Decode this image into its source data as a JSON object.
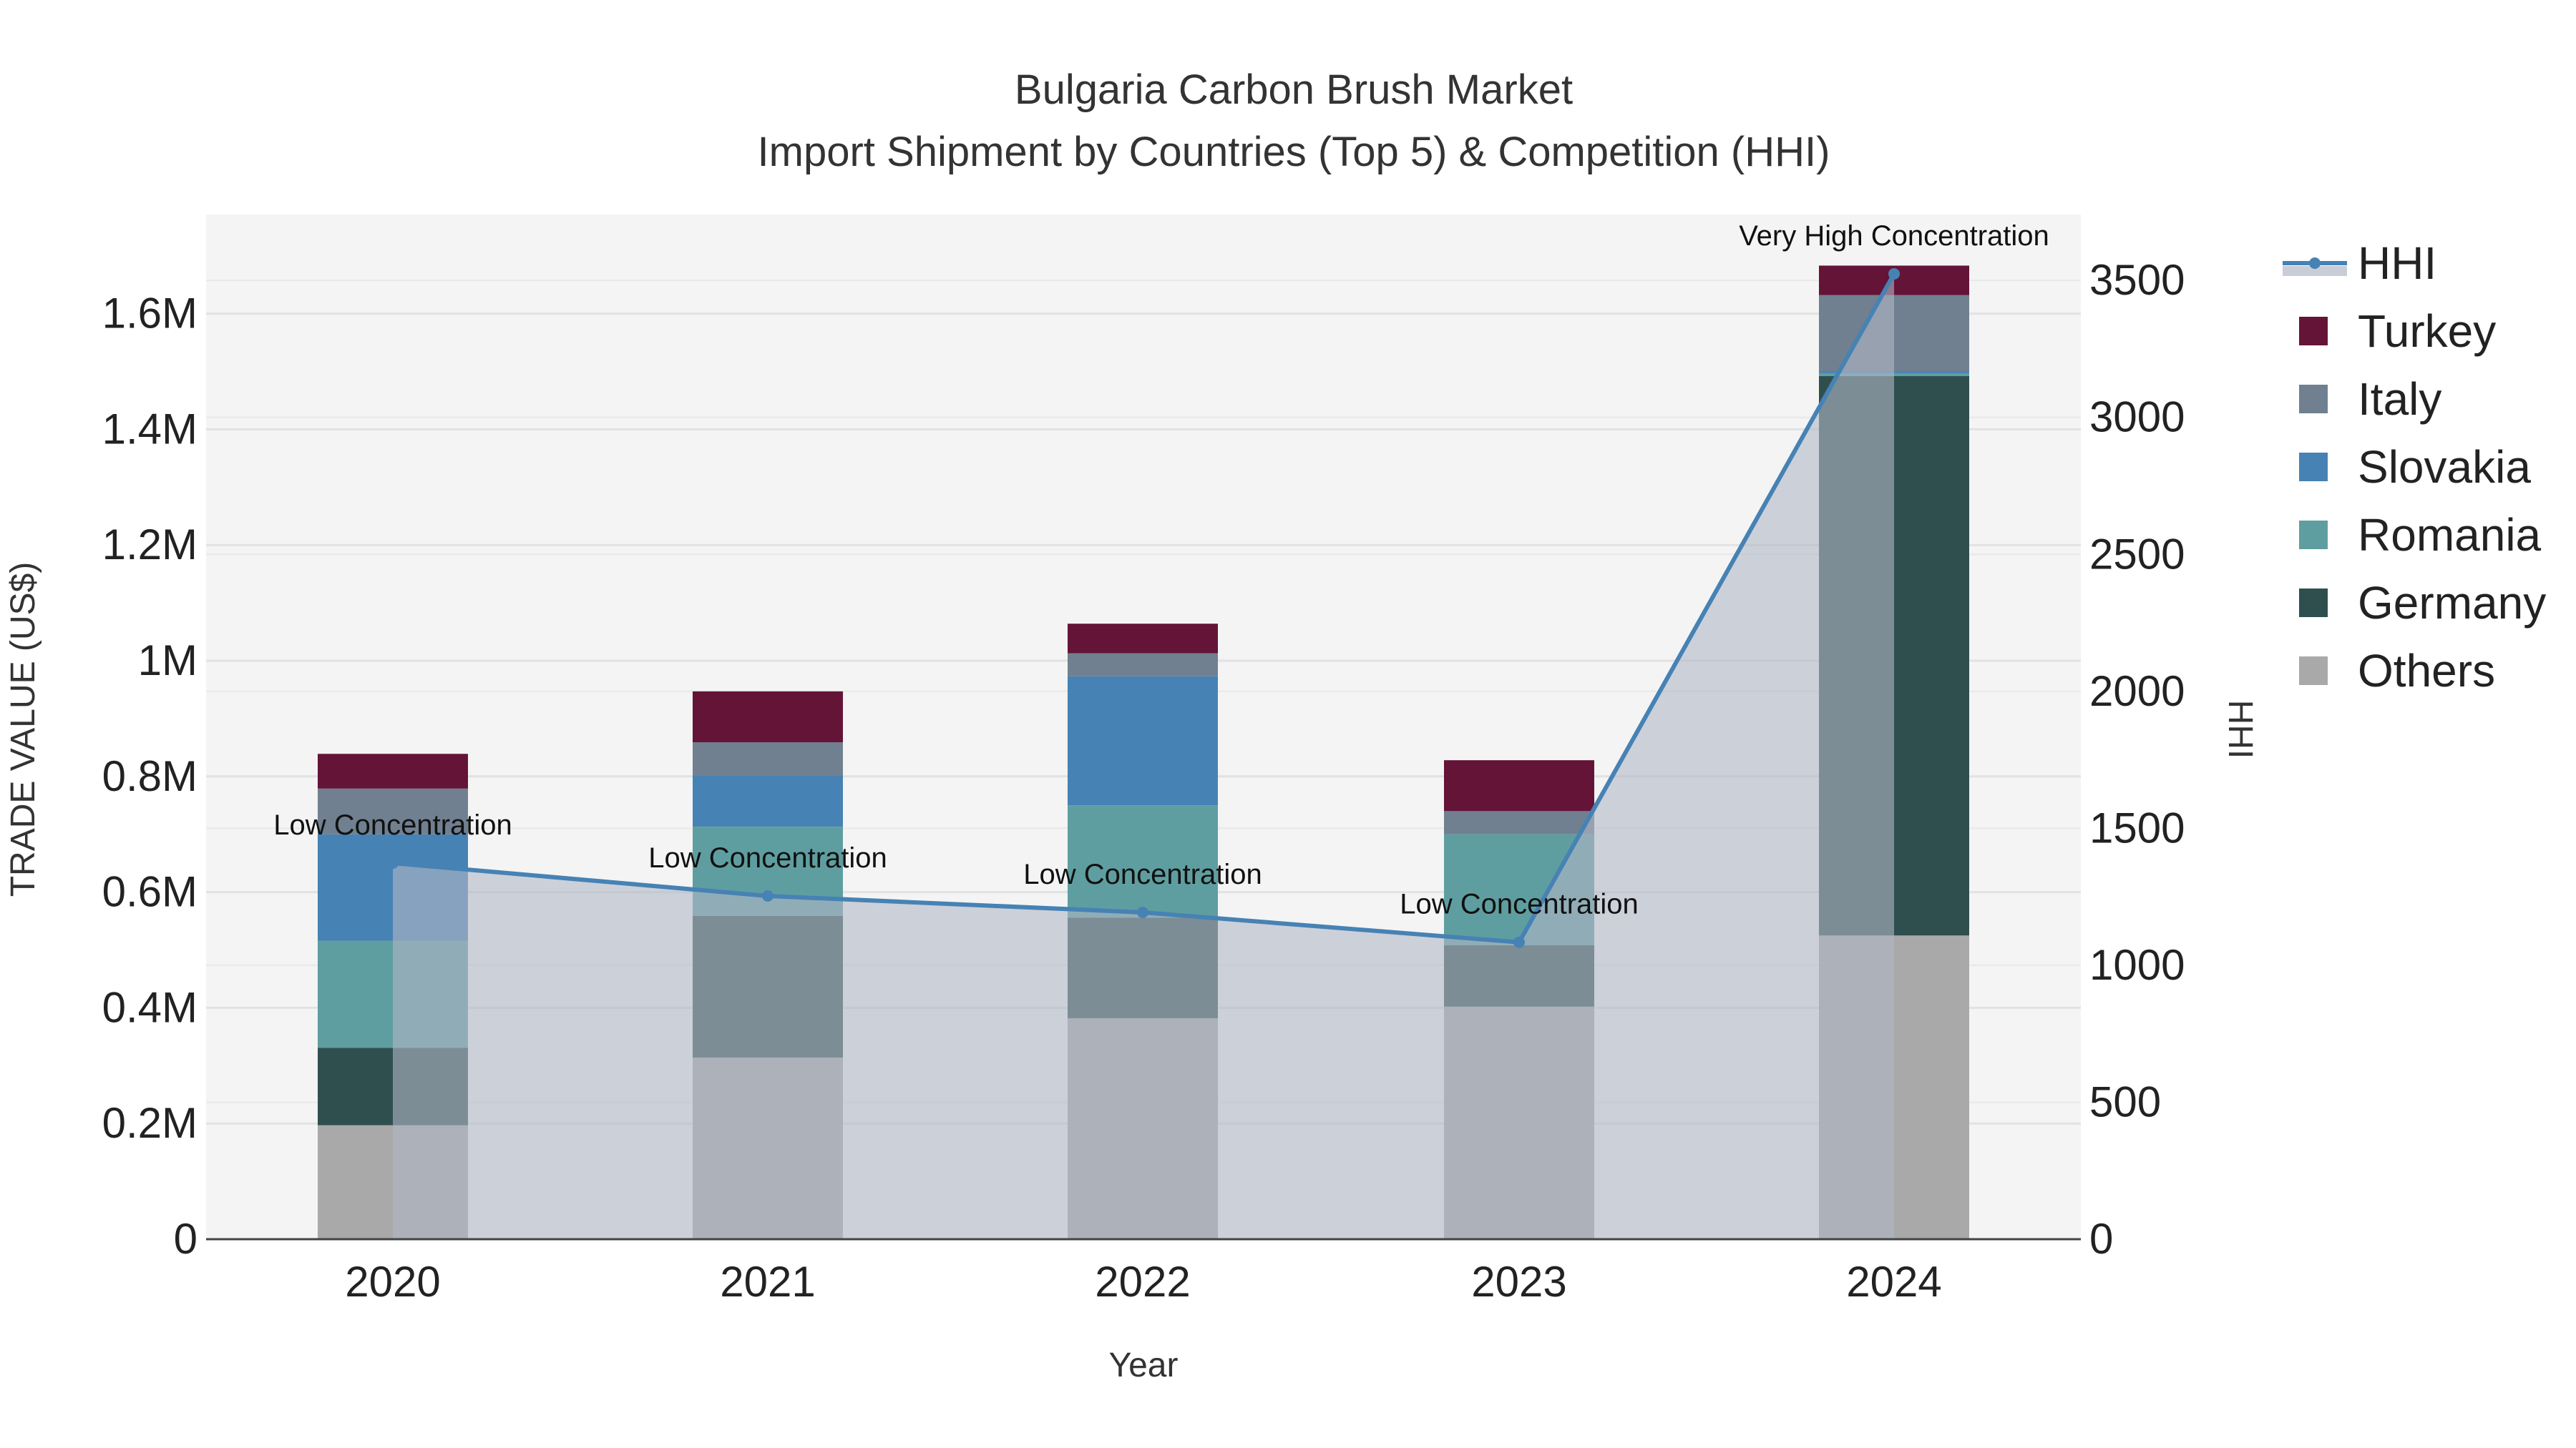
{
  "chart_data": {
    "type": "bar",
    "title": "Bulgaria Carbon Brush Market",
    "subtitle": "Import Shipment by Countries (Top 5) & Competition (HHI)",
    "xlabel": "Year",
    "ylabel": "TRADE VALUE (US$)",
    "y2label": "HHI",
    "categories": [
      "2020",
      "2021",
      "2022",
      "2023",
      "2024"
    ],
    "ylim": [
      0,
      1750000
    ],
    "y2lim": [
      0,
      3700
    ],
    "yticks": [
      0,
      200000,
      400000,
      600000,
      800000,
      1000000,
      1200000,
      1400000,
      1600000
    ],
    "ytick_labels": [
      "0",
      "0.2M",
      "0.4M",
      "0.6M",
      "0.8M",
      "1M",
      "1.2M",
      "1.4M",
      "1.6M"
    ],
    "y2ticks": [
      0,
      500,
      1000,
      1500,
      2000,
      2500,
      3000,
      3500
    ],
    "y2tick_labels": [
      "0",
      "500",
      "1000",
      "1500",
      "2000",
      "2500",
      "3000",
      "3500"
    ],
    "grid": true,
    "legend_position": "right",
    "stacked": true,
    "series": [
      {
        "name": "Others",
        "color": "#a9a9a9",
        "values": [
          197000,
          314000,
          382000,
          402000,
          525000
        ]
      },
      {
        "name": "Germany",
        "color": "#2f4f4f",
        "values": [
          134000,
          245000,
          174000,
          106000,
          967000
        ]
      },
      {
        "name": "Romania",
        "color": "#5f9ea0",
        "values": [
          185000,
          154000,
          194000,
          192000,
          5000
        ]
      },
      {
        "name": "Slovakia",
        "color": "#4682b4",
        "values": [
          184000,
          88000,
          223000,
          0,
          3000
        ]
      },
      {
        "name": "Italy",
        "color": "#708090",
        "values": [
          79000,
          58000,
          40000,
          40000,
          132000
        ]
      },
      {
        "name": "Turkey",
        "color": "#641436",
        "values": [
          60000,
          88000,
          51000,
          88000,
          51000
        ]
      }
    ],
    "hhi": {
      "name": "HHI",
      "color": "#4682b4",
      "values": [
        1373,
        1253,
        1193,
        1084,
        3524
      ],
      "annotations": [
        "Low Concentration",
        "Low Concentration",
        "Low Concentration",
        "Low Concentration",
        "Very High Concentration"
      ]
    },
    "legend_order": [
      "HHI",
      "Turkey",
      "Italy",
      "Slovakia",
      "Romania",
      "Germany",
      "Others"
    ]
  }
}
